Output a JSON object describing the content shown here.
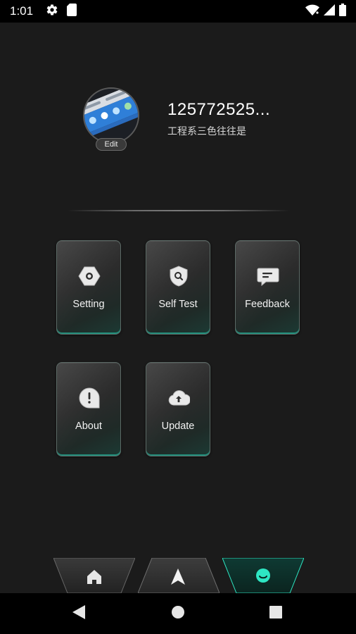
{
  "status_bar": {
    "time": "1:01",
    "left_icons": [
      "settings-gear-icon",
      "sd-card-icon"
    ],
    "right_icons": [
      "wifi-icon",
      "signal-icon",
      "battery-icon"
    ]
  },
  "profile": {
    "user_id": "125772525...",
    "subtitle": "工程系三色往往是",
    "edit_label": "Edit"
  },
  "tiles": [
    {
      "label": "Setting",
      "icon": "hexagon-gear-icon"
    },
    {
      "label": "Self Test",
      "icon": "shield-search-icon"
    },
    {
      "label": "Feedback",
      "icon": "chat-bubble-icon"
    },
    {
      "label": "About",
      "icon": "info-exclamation-icon"
    },
    {
      "label": "Update",
      "icon": "cloud-upload-icon"
    }
  ],
  "bottom_nav": {
    "items": [
      {
        "name": "home",
        "icon": "home-icon",
        "active": false
      },
      {
        "name": "navigate",
        "icon": "navigation-arrow-icon",
        "active": false
      },
      {
        "name": "profile",
        "icon": "smiley-face-icon",
        "active": true
      }
    ],
    "accent_color": "#2ee6c3"
  },
  "system_nav": {
    "icons": [
      "back-triangle-icon",
      "home-circle-icon",
      "recents-square-icon"
    ]
  }
}
